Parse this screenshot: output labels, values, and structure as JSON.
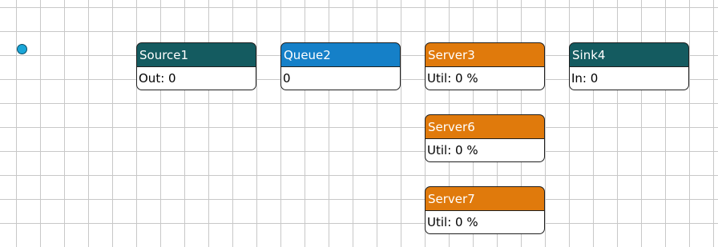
{
  "colors": {
    "source_header": "#145b60",
    "queue_header": "#1580c8",
    "server_header": "#e07a0c",
    "sink_header": "#145b60",
    "origin_dot": "#1aa6d8",
    "grid_line": "#c8c8c8"
  },
  "blocks": {
    "source1": {
      "name": "Source1",
      "stat": "Out: 0"
    },
    "queue2": {
      "name": "Queue2",
      "stat": "0"
    },
    "server3": {
      "name": "Server3",
      "stat": "Util: 0 %"
    },
    "sink4": {
      "name": "Sink4",
      "stat": "In: 0"
    },
    "server6": {
      "name": "Server6",
      "stat": "Util: 0 %"
    },
    "server7": {
      "name": "Server7",
      "stat": "Util: 0 %"
    }
  }
}
